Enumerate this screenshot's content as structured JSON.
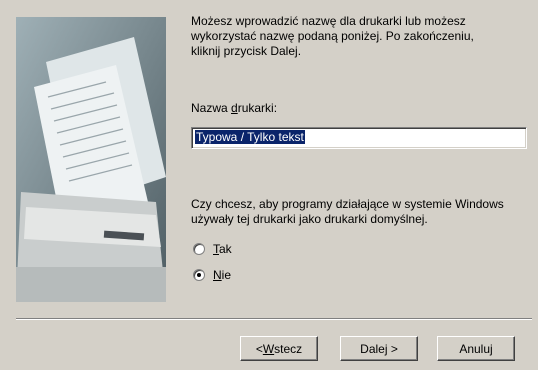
{
  "intro": {
    "line1": "Możesz wprowadzić nazwę dla drukarki lub możesz",
    "line2": "wykorzystać nazwę podaną poniżej. Po zakończeniu,",
    "line3": "kliknij przycisk Dalej."
  },
  "printer_name": {
    "label_prefix": "Nazwa ",
    "label_accel": "d",
    "label_suffix": "rukarki:",
    "value": "Typowa / Tylko tekst"
  },
  "default_question": {
    "line1": "Czy chcesz, aby programy działające w systemie Windows",
    "line2": "używały tej drukarki jako drukarki domyślnej."
  },
  "options": [
    {
      "accel": "T",
      "rest": "ak",
      "checked": false
    },
    {
      "accel": "N",
      "rest": "ie",
      "checked": true
    }
  ],
  "buttons": {
    "back": {
      "prefix": "< ",
      "accel": "W",
      "rest": "stecz"
    },
    "next": "Dalej >",
    "cancel": "Anuluj"
  }
}
